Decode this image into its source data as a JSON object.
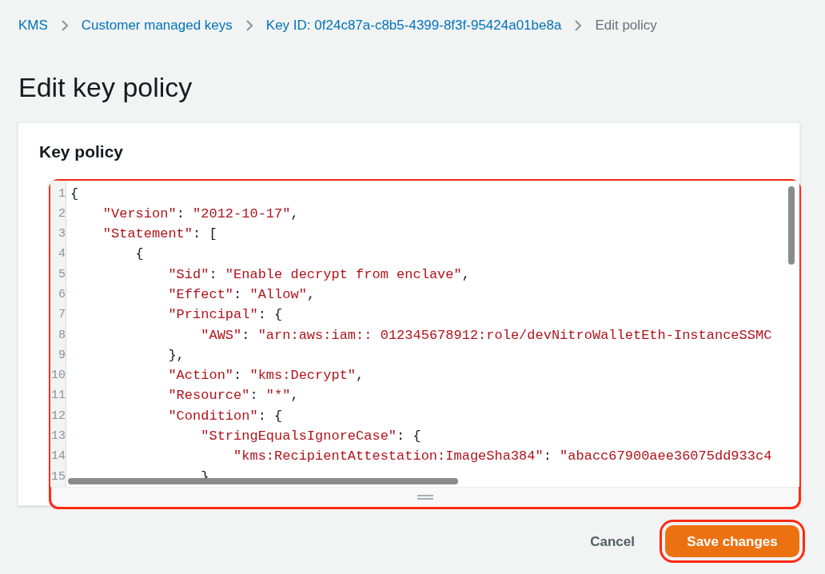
{
  "breadcrumbs": [
    {
      "label": "KMS",
      "kind": "link"
    },
    {
      "label": "Customer managed keys",
      "kind": "link"
    },
    {
      "label": "Key ID: 0f24c87a-c8b5-4399-8f3f-95424a01be8a",
      "kind": "link"
    },
    {
      "label": "Edit policy",
      "kind": "current"
    }
  ],
  "page_title": "Edit key policy",
  "panel": {
    "title": "Key policy",
    "editor": {
      "highlighted": true,
      "lines": [
        {
          "number": "1",
          "segments": [
            {
              "kind": "punct",
              "text": "{"
            }
          ]
        },
        {
          "number": "2",
          "segments": [
            {
              "kind": "string",
              "text": "    \"Version\""
            },
            {
              "kind": "punct",
              "text": ": "
            },
            {
              "kind": "string",
              "text": "\"2012-10-17\""
            },
            {
              "kind": "punct",
              "text": ","
            }
          ]
        },
        {
          "number": "3",
          "segments": [
            {
              "kind": "string",
              "text": "    \"Statement\""
            },
            {
              "kind": "punct",
              "text": ": ["
            }
          ]
        },
        {
          "number": "4",
          "segments": [
            {
              "kind": "punct",
              "text": "        {"
            }
          ]
        },
        {
          "number": "5",
          "segments": [
            {
              "kind": "string",
              "text": "            \"Sid\""
            },
            {
              "kind": "punct",
              "text": ": "
            },
            {
              "kind": "string",
              "text": "\"Enable decrypt from enclave\""
            },
            {
              "kind": "punct",
              "text": ","
            }
          ]
        },
        {
          "number": "6",
          "segments": [
            {
              "kind": "string",
              "text": "            \"Effect\""
            },
            {
              "kind": "punct",
              "text": ": "
            },
            {
              "kind": "string",
              "text": "\"Allow\""
            },
            {
              "kind": "punct",
              "text": ","
            }
          ]
        },
        {
          "number": "7",
          "segments": [
            {
              "kind": "string",
              "text": "            \"Principal\""
            },
            {
              "kind": "punct",
              "text": ": {"
            }
          ]
        },
        {
          "number": "8",
          "segments": [
            {
              "kind": "string",
              "text": "                \"AWS\""
            },
            {
              "kind": "punct",
              "text": ": "
            },
            {
              "kind": "string",
              "text": "\"arn:aws:iam:: 012345678912:role/devNitroWalletEth-InstanceSSMC"
            }
          ]
        },
        {
          "number": "9",
          "segments": [
            {
              "kind": "punct",
              "text": "            },"
            }
          ]
        },
        {
          "number": "10",
          "segments": [
            {
              "kind": "string",
              "text": "            \"Action\""
            },
            {
              "kind": "punct",
              "text": ": "
            },
            {
              "kind": "string",
              "text": "\"kms:Decrypt\""
            },
            {
              "kind": "punct",
              "text": ","
            }
          ]
        },
        {
          "number": "11",
          "segments": [
            {
              "kind": "string",
              "text": "            \"Resource\""
            },
            {
              "kind": "punct",
              "text": ": "
            },
            {
              "kind": "string",
              "text": "\"*\""
            },
            {
              "kind": "punct",
              "text": ","
            }
          ]
        },
        {
          "number": "12",
          "segments": [
            {
              "kind": "string",
              "text": "            \"Condition\""
            },
            {
              "kind": "punct",
              "text": ": {"
            }
          ]
        },
        {
          "number": "13",
          "segments": [
            {
              "kind": "string",
              "text": "                \"StringEqualsIgnoreCase\""
            },
            {
              "kind": "punct",
              "text": ": {"
            }
          ]
        },
        {
          "number": "14",
          "segments": [
            {
              "kind": "string",
              "text": "                    \"kms:RecipientAttestation:ImageSha384\""
            },
            {
              "kind": "punct",
              "text": ": "
            },
            {
              "kind": "string",
              "text": "\"abacc67900aee36075dd933c4"
            }
          ]
        },
        {
          "number": "15",
          "segments": [
            {
              "kind": "punct",
              "text": "                }"
            }
          ]
        }
      ]
    }
  },
  "buttons": [
    {
      "label": "Cancel",
      "kind": "link",
      "highlighted": false
    },
    {
      "label": "Save changes",
      "kind": "primary",
      "highlighted": true
    }
  ]
}
